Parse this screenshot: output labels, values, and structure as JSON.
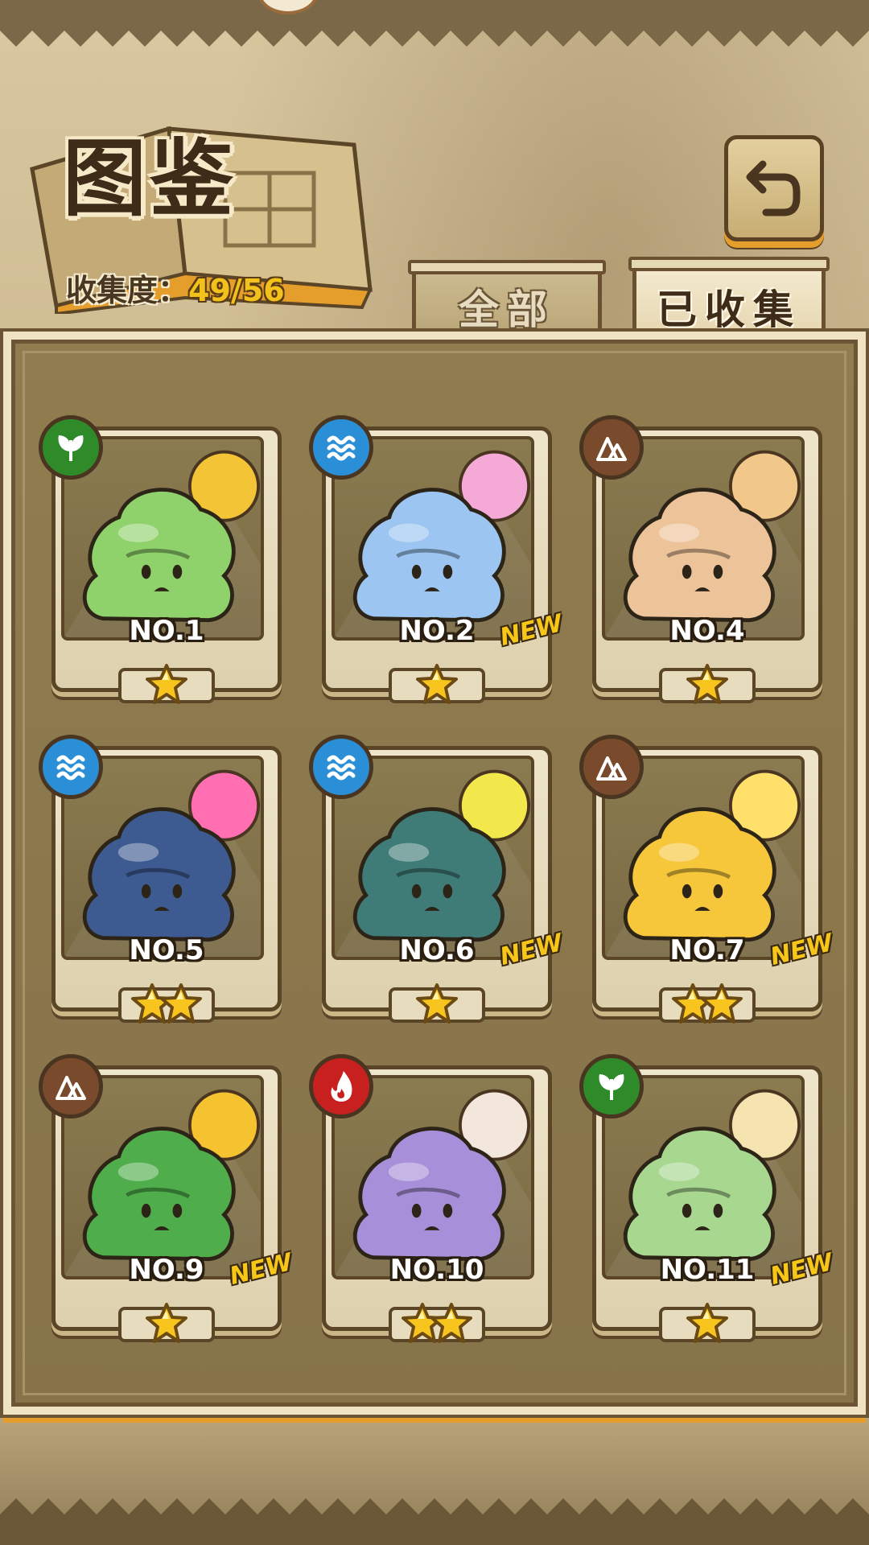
{
  "header": {
    "title": "图鉴",
    "collection_label": "收集度：",
    "collection_value": "49/56"
  },
  "back_button": {
    "icon": "return-arrow-icon"
  },
  "tabs": [
    {
      "label": "全部",
      "active": false
    },
    {
      "label": "已收集",
      "active": true
    }
  ],
  "colors": {
    "grass": "#2f8a2a",
    "water": "#2a8fd6",
    "earth": "#7a4a2c",
    "fire": "#c8201e",
    "accent_gold": "#f2c11b",
    "tab_orange": "#e59d2b"
  },
  "cards": [
    {
      "number": "NO.1",
      "element": "grass-leaf-icon",
      "stars": 1,
      "new": false,
      "body": "#8fd16b",
      "accent": "#f3c536"
    },
    {
      "number": "NO.2",
      "element": "water-wave-icon",
      "stars": 1,
      "new": true,
      "body": "#9cc5f2",
      "accent": "#f4a9d7"
    },
    {
      "number": "NO.4",
      "element": "earth-rock-icon",
      "stars": 1,
      "new": false,
      "body": "#edc49a",
      "accent": "#f2c88a"
    },
    {
      "number": "NO.5",
      "element": "water-wave-icon",
      "stars": 2,
      "new": false,
      "body": "#3e5b91",
      "accent": "#ff6fb1"
    },
    {
      "number": "NO.6",
      "element": "water-wave-icon",
      "stars": 1,
      "new": true,
      "body": "#3f7c77",
      "accent": "#f2e84b"
    },
    {
      "number": "NO.7",
      "element": "earth-rock-icon",
      "stars": 2,
      "new": true,
      "body": "#f6c63b",
      "accent": "#ffe06a"
    },
    {
      "number": "NO.9",
      "element": "earth-rock-icon",
      "stars": 1,
      "new": true,
      "body": "#4fae4b",
      "accent": "#f5c330"
    },
    {
      "number": "NO.10",
      "element": "fire-flame-icon",
      "stars": 2,
      "new": false,
      "body": "#a88fd9",
      "accent": "#f3e6da"
    },
    {
      "number": "NO.11",
      "element": "grass-leaf-icon",
      "stars": 1,
      "new": true,
      "body": "#a8d890",
      "accent": "#f5e3b0"
    }
  ],
  "new_badge_label": "NEW"
}
